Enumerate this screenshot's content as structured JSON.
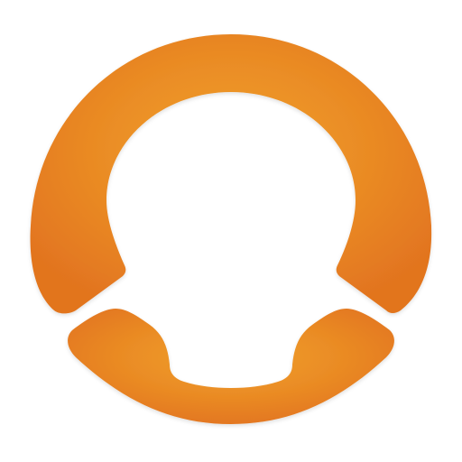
{
  "app_icon": {
    "name": "orange-ring-phone-logo",
    "colors": {
      "background": "#ffffff",
      "orange_light": "#f0a12e",
      "orange_mid": "#ea8b24",
      "orange_dark": "#e2741f"
    }
  }
}
